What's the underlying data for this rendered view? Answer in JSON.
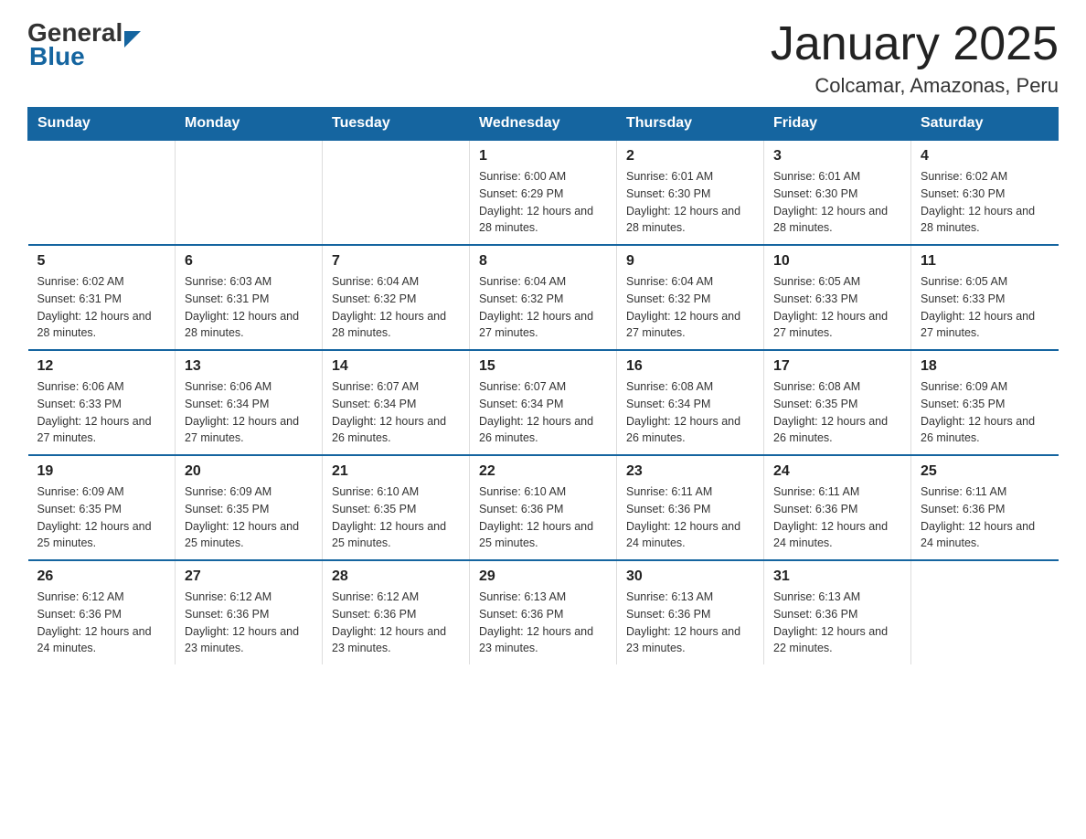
{
  "logo": {
    "general": "General",
    "blue": "Blue",
    "arrow_color": "#1565a0"
  },
  "header": {
    "title": "January 2025",
    "subtitle": "Colcamar, Amazonas, Peru"
  },
  "days_of_week": [
    "Sunday",
    "Monday",
    "Tuesday",
    "Wednesday",
    "Thursday",
    "Friday",
    "Saturday"
  ],
  "weeks": [
    [
      {
        "day": "",
        "info": ""
      },
      {
        "day": "",
        "info": ""
      },
      {
        "day": "",
        "info": ""
      },
      {
        "day": "1",
        "info": "Sunrise: 6:00 AM\nSunset: 6:29 PM\nDaylight: 12 hours and 28 minutes."
      },
      {
        "day": "2",
        "info": "Sunrise: 6:01 AM\nSunset: 6:30 PM\nDaylight: 12 hours and 28 minutes."
      },
      {
        "day": "3",
        "info": "Sunrise: 6:01 AM\nSunset: 6:30 PM\nDaylight: 12 hours and 28 minutes."
      },
      {
        "day": "4",
        "info": "Sunrise: 6:02 AM\nSunset: 6:30 PM\nDaylight: 12 hours and 28 minutes."
      }
    ],
    [
      {
        "day": "5",
        "info": "Sunrise: 6:02 AM\nSunset: 6:31 PM\nDaylight: 12 hours and 28 minutes."
      },
      {
        "day": "6",
        "info": "Sunrise: 6:03 AM\nSunset: 6:31 PM\nDaylight: 12 hours and 28 minutes."
      },
      {
        "day": "7",
        "info": "Sunrise: 6:04 AM\nSunset: 6:32 PM\nDaylight: 12 hours and 28 minutes."
      },
      {
        "day": "8",
        "info": "Sunrise: 6:04 AM\nSunset: 6:32 PM\nDaylight: 12 hours and 27 minutes."
      },
      {
        "day": "9",
        "info": "Sunrise: 6:04 AM\nSunset: 6:32 PM\nDaylight: 12 hours and 27 minutes."
      },
      {
        "day": "10",
        "info": "Sunrise: 6:05 AM\nSunset: 6:33 PM\nDaylight: 12 hours and 27 minutes."
      },
      {
        "day": "11",
        "info": "Sunrise: 6:05 AM\nSunset: 6:33 PM\nDaylight: 12 hours and 27 minutes."
      }
    ],
    [
      {
        "day": "12",
        "info": "Sunrise: 6:06 AM\nSunset: 6:33 PM\nDaylight: 12 hours and 27 minutes."
      },
      {
        "day": "13",
        "info": "Sunrise: 6:06 AM\nSunset: 6:34 PM\nDaylight: 12 hours and 27 minutes."
      },
      {
        "day": "14",
        "info": "Sunrise: 6:07 AM\nSunset: 6:34 PM\nDaylight: 12 hours and 26 minutes."
      },
      {
        "day": "15",
        "info": "Sunrise: 6:07 AM\nSunset: 6:34 PM\nDaylight: 12 hours and 26 minutes."
      },
      {
        "day": "16",
        "info": "Sunrise: 6:08 AM\nSunset: 6:34 PM\nDaylight: 12 hours and 26 minutes."
      },
      {
        "day": "17",
        "info": "Sunrise: 6:08 AM\nSunset: 6:35 PM\nDaylight: 12 hours and 26 minutes."
      },
      {
        "day": "18",
        "info": "Sunrise: 6:09 AM\nSunset: 6:35 PM\nDaylight: 12 hours and 26 minutes."
      }
    ],
    [
      {
        "day": "19",
        "info": "Sunrise: 6:09 AM\nSunset: 6:35 PM\nDaylight: 12 hours and 25 minutes."
      },
      {
        "day": "20",
        "info": "Sunrise: 6:09 AM\nSunset: 6:35 PM\nDaylight: 12 hours and 25 minutes."
      },
      {
        "day": "21",
        "info": "Sunrise: 6:10 AM\nSunset: 6:35 PM\nDaylight: 12 hours and 25 minutes."
      },
      {
        "day": "22",
        "info": "Sunrise: 6:10 AM\nSunset: 6:36 PM\nDaylight: 12 hours and 25 minutes."
      },
      {
        "day": "23",
        "info": "Sunrise: 6:11 AM\nSunset: 6:36 PM\nDaylight: 12 hours and 24 minutes."
      },
      {
        "day": "24",
        "info": "Sunrise: 6:11 AM\nSunset: 6:36 PM\nDaylight: 12 hours and 24 minutes."
      },
      {
        "day": "25",
        "info": "Sunrise: 6:11 AM\nSunset: 6:36 PM\nDaylight: 12 hours and 24 minutes."
      }
    ],
    [
      {
        "day": "26",
        "info": "Sunrise: 6:12 AM\nSunset: 6:36 PM\nDaylight: 12 hours and 24 minutes."
      },
      {
        "day": "27",
        "info": "Sunrise: 6:12 AM\nSunset: 6:36 PM\nDaylight: 12 hours and 23 minutes."
      },
      {
        "day": "28",
        "info": "Sunrise: 6:12 AM\nSunset: 6:36 PM\nDaylight: 12 hours and 23 minutes."
      },
      {
        "day": "29",
        "info": "Sunrise: 6:13 AM\nSunset: 6:36 PM\nDaylight: 12 hours and 23 minutes."
      },
      {
        "day": "30",
        "info": "Sunrise: 6:13 AM\nSunset: 6:36 PM\nDaylight: 12 hours and 23 minutes."
      },
      {
        "day": "31",
        "info": "Sunrise: 6:13 AM\nSunset: 6:36 PM\nDaylight: 12 hours and 22 minutes."
      },
      {
        "day": "",
        "info": ""
      }
    ]
  ]
}
